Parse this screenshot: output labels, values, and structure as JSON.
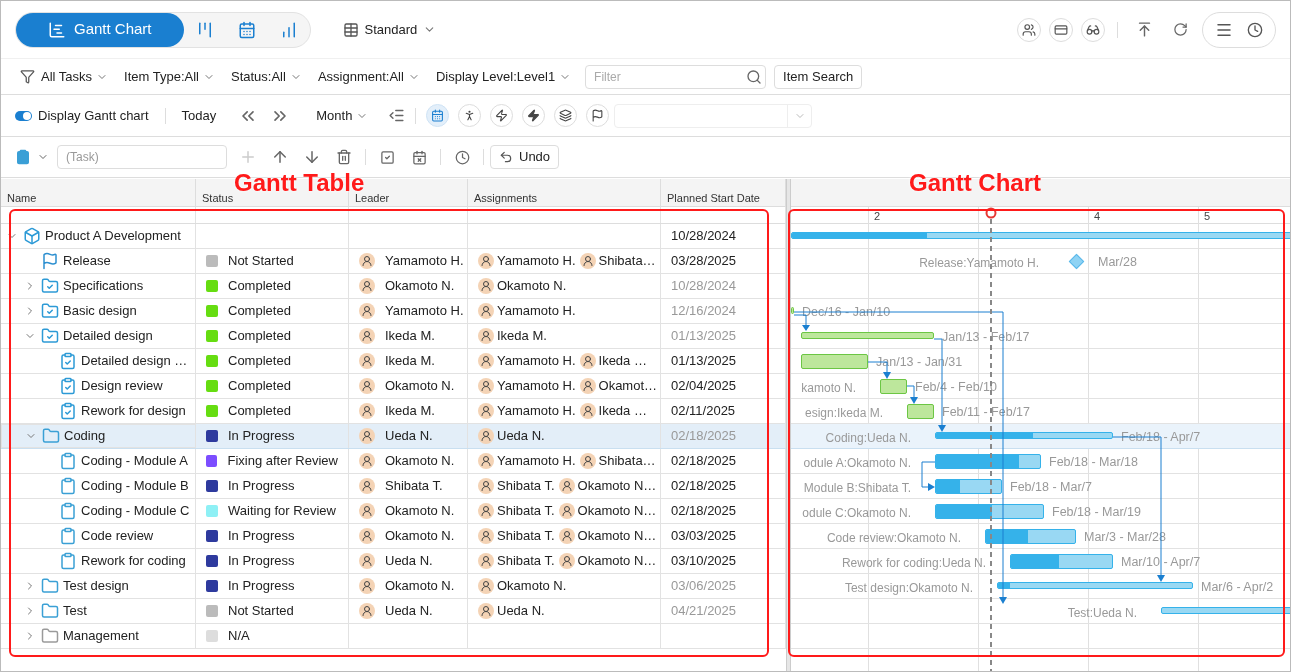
{
  "view_tabs": [
    {
      "kind": "gantt",
      "label": "Gantt Chart",
      "selected": true
    },
    {
      "kind": "kanban",
      "selected": false
    },
    {
      "kind": "calendar",
      "selected": false
    },
    {
      "kind": "chart",
      "selected": false
    }
  ],
  "layout_menu": {
    "label": "Standard"
  },
  "filters": [
    {
      "label": "All Tasks"
    },
    {
      "label": "Item Type:All"
    },
    {
      "label": "Status:All"
    },
    {
      "label": "Assignment:All"
    },
    {
      "label": "Display Level:Level1"
    }
  ],
  "filter_field": {
    "placeholder": "Filter"
  },
  "item_search_button": "Item Search",
  "gantt_toggle": {
    "label": "Display Gantt chart",
    "on": true
  },
  "today_button": "Today",
  "scale_menu": {
    "label": "Month"
  },
  "chart_tools": [
    {
      "kind": "calendar",
      "selected": true
    },
    {
      "kind": "walk",
      "selected": false
    },
    {
      "kind": "bolt",
      "selected": false
    },
    {
      "kind": "bolt-filled",
      "selected": false
    },
    {
      "kind": "layers",
      "selected": false
    },
    {
      "kind": "flag",
      "selected": false
    }
  ],
  "task_field": {
    "placeholder": "(Task)"
  },
  "undo_button": "Undo",
  "table": {
    "columns": [
      "Name",
      "Status",
      "Leader",
      "Assignments",
      "Planned Start Date"
    ],
    "rows": [
      {
        "kind": "project",
        "name": "Product A Development",
        "expanded": true,
        "selected": false,
        "start": "10/28/2024",
        "muted": false,
        "bar": {
          "kind": "summary",
          "color": "#35b2ea",
          "level": 0.27
        },
        "children": [
          {
            "kind": "milestone",
            "name": "Release",
            "selected": false,
            "status": {
              "label": "Not Started",
              "color": "#bbbbbb"
            },
            "leader": "Yamamoto H.",
            "assignments": [
              "Yamamoto H.",
              "Shibata…"
            ],
            "start": "03/28/2025",
            "muted": false,
            "bar": {
              "kind": "milestone",
              "color": "#8fd3f4",
              "label": "Release:Yamamoto H.",
              "range": "Mar/28"
            }
          },
          {
            "kind": "folder-done",
            "name": "Specifications",
            "expanded": false,
            "selected": false,
            "status": {
              "label": "Completed",
              "color": "#66dd11"
            },
            "leader": "Okamoto N.",
            "assignments": [
              "Okamoto N."
            ],
            "start": "10/28/2024",
            "muted": true
          },
          {
            "kind": "folder-done",
            "name": "Basic design",
            "expanded": false,
            "selected": false,
            "status": {
              "label": "Completed",
              "color": "#66dd11"
            },
            "leader": "Yamamoto H.",
            "assignments": [
              "Yamamoto H."
            ],
            "start": "12/16/2024",
            "muted": true,
            "bar": {
              "kind": "summary",
              "color": "#6cc644",
              "range": "Dec/16 - Jan/10"
            }
          },
          {
            "kind": "folder-done",
            "name": "Detailed design",
            "expanded": true,
            "selected": false,
            "status": {
              "label": "Completed",
              "color": "#66dd11"
            },
            "leader": "Ikeda M.",
            "assignments": [
              "Ikeda M."
            ],
            "start": "01/13/2025",
            "muted": true,
            "bar": {
              "kind": "summary",
              "color": "#6cc644",
              "range": "Jan/13 - Feb/17"
            },
            "children": [
              {
                "kind": "task-done",
                "name": "Detailed design …",
                "selected": false,
                "status": {
                  "label": "Completed",
                  "color": "#66dd11"
                },
                "leader": "Ikeda M.",
                "assignments": [
                  "Yamamoto H.",
                  "Ikeda …"
                ],
                "start": "01/13/2025",
                "muted": false,
                "bar": {
                  "kind": "task",
                  "color": "#6cc644",
                  "range": "Jan/13 - Jan/31"
                }
              },
              {
                "kind": "task-done",
                "name": "Design review",
                "selected": false,
                "status": {
                  "label": "Completed",
                  "color": "#66dd11"
                },
                "leader": "Okamoto N.",
                "assignments": [
                  "Yamamoto H.",
                  "Okamot…"
                ],
                "start": "02/04/2025",
                "muted": false,
                "bar": {
                  "kind": "task",
                  "color": "#6cc644",
                  "label": "kamoto N.",
                  "range": "Feb/4 - Feb/10"
                }
              },
              {
                "kind": "task-done",
                "name": "Rework for design",
                "selected": false,
                "status": {
                  "label": "Completed",
                  "color": "#66dd11"
                },
                "leader": "Ikeda M.",
                "assignments": [
                  "Yamamoto H.",
                  "Ikeda …"
                ],
                "start": "02/11/2025",
                "muted": false,
                "bar": {
                  "kind": "task",
                  "color": "#6cc644",
                  "label": "esign:Ikeda M.",
                  "range": "Feb/11 - Feb/17"
                }
              }
            ]
          },
          {
            "kind": "folder",
            "name": "Coding",
            "expanded": true,
            "selected": true,
            "status": {
              "label": "In Progress",
              "color": "#2e3a9e"
            },
            "leader": "Ueda N.",
            "assignments": [
              "Ueda N."
            ],
            "start": "02/18/2025",
            "muted": true,
            "bar": {
              "kind": "summary",
              "color": "#35b2ea",
              "level": 0.55,
              "label": "Coding:Ueda N.",
              "range": "Feb/18 - Apr/7"
            },
            "children": [
              {
                "kind": "task",
                "name": "Coding - Module A",
                "selected": false,
                "status": {
                  "label": "Fixing after Review",
                  "color": "#7c4dff"
                },
                "leader": "Okamoto N.",
                "assignments": [
                  "Yamamoto H.",
                  "Shibata…"
                ],
                "start": "02/18/2025",
                "muted": false,
                "bar": {
                  "kind": "task",
                  "color": "#35b2ea",
                  "level": 0.8,
                  "label": "odule A:Okamoto N.",
                  "range": "Feb/18 - Mar/18"
                }
              },
              {
                "kind": "task",
                "name": "Coding - Module B",
                "selected": false,
                "status": {
                  "label": "In Progress",
                  "color": "#2e3a9e"
                },
                "leader": "Shibata T.",
                "assignments": [
                  "Shibata T.",
                  "Okamoto N…"
                ],
                "start": "02/18/2025",
                "muted": false,
                "bar": {
                  "kind": "task",
                  "color": "#35b2ea",
                  "level": 0.37,
                  "label": "Module B:Shibata T.",
                  "range": "Feb/18 - Mar/7"
                }
              },
              {
                "kind": "task",
                "name": "Coding - Module C",
                "selected": false,
                "status": {
                  "label": "Waiting for Review",
                  "color": "#8ef0f5"
                },
                "leader": "Okamoto N.",
                "assignments": [
                  "Shibata T.",
                  "Okamoto N…"
                ],
                "start": "02/18/2025",
                "muted": false,
                "bar": {
                  "kind": "task",
                  "color": "#35b2ea",
                  "level": 0.52,
                  "label": "odule C:Okamoto N.",
                  "range": "Feb/18 - Mar/19"
                }
              },
              {
                "kind": "task",
                "name": "Code review",
                "selected": false,
                "status": {
                  "label": "In Progress",
                  "color": "#2e3a9e"
                },
                "leader": "Okamoto N.",
                "assignments": [
                  "Shibata T.",
                  "Okamoto N…"
                ],
                "start": "03/03/2025",
                "muted": false,
                "bar": {
                  "kind": "task",
                  "color": "#35b2ea",
                  "level": 0.47,
                  "label": "Code review:Okamoto N.",
                  "range": "Mar/3 - Mar/28"
                }
              },
              {
                "kind": "task",
                "name": "Rework for coding",
                "selected": false,
                "status": {
                  "label": "In Progress",
                  "color": "#2e3a9e"
                },
                "leader": "Ueda N.",
                "assignments": [
                  "Shibata T.",
                  "Okamoto N…"
                ],
                "start": "03/10/2025",
                "muted": false,
                "bar": {
                  "kind": "task",
                  "color": "#35b2ea",
                  "level": 0.48,
                  "label": "Rework for coding:Ueda N.",
                  "range": "Mar/10 - Apr/7"
                }
              }
            ]
          },
          {
            "kind": "folder",
            "name": "Test design",
            "expanded": false,
            "selected": false,
            "status": {
              "label": "In Progress",
              "color": "#2e3a9e"
            },
            "leader": "Okamoto N.",
            "assignments": [
              "Okamoto N."
            ],
            "start": "03/06/2025",
            "muted": true,
            "bar": {
              "kind": "summary",
              "color": "#35b2ea",
              "level": 0.06,
              "label": "Test design:Okamoto N.",
              "range": "Mar/6 - Apr/2"
            }
          },
          {
            "kind": "folder",
            "name": "Test",
            "expanded": false,
            "selected": false,
            "status": {
              "label": "Not Started",
              "color": "#bbbbbb"
            },
            "leader": "Ueda N.",
            "assignments": [
              "Ueda N."
            ],
            "start": "04/21/2025",
            "muted": true,
            "bar": {
              "kind": "summary",
              "color": "#35b2ea",
              "label": "Test:Ueda N."
            }
          },
          {
            "kind": "folder-grey",
            "name": "Management",
            "expanded": false,
            "selected": false,
            "status": {
              "label": "N/A",
              "color": "#dddddd"
            }
          }
        ]
      }
    ]
  },
  "timeline": {
    "months": [
      "2",
      "4",
      "5"
    ]
  },
  "annotations": [
    {
      "label": "Gantt Table"
    },
    {
      "label": "Gantt Chart"
    }
  ]
}
